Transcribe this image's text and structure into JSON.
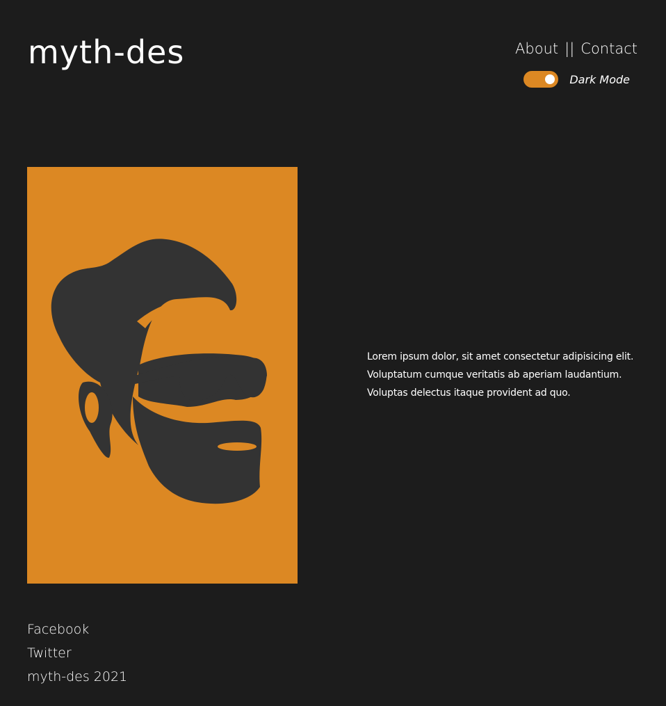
{
  "header": {
    "logo": "myth-des",
    "nav": {
      "about": "About",
      "separator": "||",
      "contact": "Contact"
    },
    "theme_toggle": {
      "label": "Dark Mode",
      "enabled": true
    }
  },
  "main": {
    "intro_text": "Lorem ipsum dolor, sit amet consectetur adipisicing elit. Voluptatum cumque veritatis ab aperiam laudantium. Voluptas delectus itaque provident ad quo."
  },
  "footer": {
    "facebook": "Facebook",
    "twitter": "Twitter",
    "copyright": "myth-des 2021"
  },
  "colors": {
    "background": "#1c1c1c",
    "accent": "#dc8823",
    "illustration_fill": "#333333",
    "text": "#ffffff"
  },
  "icons": {
    "hero": "bearded-man-sunglasses-illustration"
  }
}
